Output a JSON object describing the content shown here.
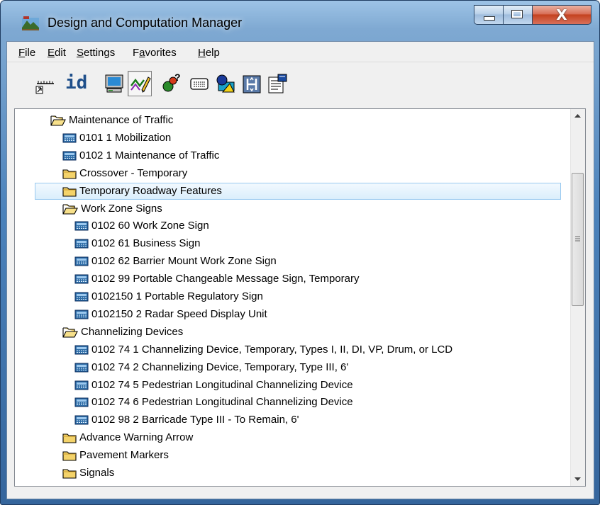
{
  "window": {
    "title": "Design and Computation Manager",
    "close_glyph": "X"
  },
  "menu": [
    {
      "label": "File"
    },
    {
      "label": "Edit"
    },
    {
      "label": "Settings"
    },
    {
      "label": "Favorites"
    },
    {
      "label": "Help"
    }
  ],
  "toolbar": {
    "id_label": "id",
    "buttons": [
      {
        "icon": "element-id-icon"
      },
      {
        "icon": "id-icon"
      },
      {
        "icon": "monitor-icon"
      },
      {
        "icon": "draw-pen-icon",
        "pressed": true
      },
      {
        "icon": "shapes-icon"
      },
      {
        "icon": "keyboard-icon"
      },
      {
        "icon": "place-shapes-icon"
      },
      {
        "icon": "compute-icon"
      },
      {
        "icon": "properties-icon"
      }
    ]
  },
  "tree": {
    "items": [
      {
        "level": 0,
        "type": "folder-open",
        "label": "Maintenance of Traffic"
      },
      {
        "level": 1,
        "type": "item",
        "label": "0101  1 Mobilization"
      },
      {
        "level": 1,
        "type": "item",
        "label": "0102  1 Maintenance of Traffic"
      },
      {
        "level": 1,
        "type": "folder",
        "label": "Crossover - Temporary"
      },
      {
        "level": 1,
        "type": "folder",
        "label": "Temporary Roadway Features",
        "selected": true
      },
      {
        "level": 1,
        "type": "folder-open",
        "label": "Work Zone Signs"
      },
      {
        "level": 2,
        "type": "item",
        "label": "0102 60 Work Zone Sign"
      },
      {
        "level": 2,
        "type": "item",
        "label": "0102 61 Business Sign"
      },
      {
        "level": 2,
        "type": "item",
        "label": "0102 62 Barrier Mount Work Zone Sign"
      },
      {
        "level": 2,
        "type": "item",
        "label": "0102 99 Portable Changeable Message Sign, Temporary"
      },
      {
        "level": 2,
        "type": "item",
        "label": "0102150  1 Portable Regulatory Sign"
      },
      {
        "level": 2,
        "type": "item",
        "label": "0102150  2 Radar Speed Display Unit"
      },
      {
        "level": 1,
        "type": "folder-open",
        "label": "Channelizing Devices"
      },
      {
        "level": 2,
        "type": "item",
        "label": "0102 74  1 Channelizing Device, Temporary, Types I, II, DI, VP, Drum, or LCD"
      },
      {
        "level": 2,
        "type": "item",
        "label": "0102 74  2 Channelizing Device, Temporary, Type III, 6'"
      },
      {
        "level": 2,
        "type": "item",
        "label": "0102 74  5 Pedestrian Longitudinal Channelizing Device"
      },
      {
        "level": 2,
        "type": "item",
        "label": "0102 74  6 Pedestrian Longitudinal Channelizing Device"
      },
      {
        "level": 2,
        "type": "item",
        "label": "0102 98  2 Barricade Type III - To Remain, 6'"
      },
      {
        "level": 1,
        "type": "folder",
        "label": "Advance Warning Arrow"
      },
      {
        "level": 1,
        "type": "folder",
        "label": "Pavement Markers"
      },
      {
        "level": 1,
        "type": "folder",
        "label": "Signals"
      }
    ]
  },
  "colors": {
    "selection_fill": "#daeefc",
    "selection_border": "#99c9ef",
    "folder_yellow": "#f4d36a",
    "item_icon_blue": "#2f6ea8"
  }
}
